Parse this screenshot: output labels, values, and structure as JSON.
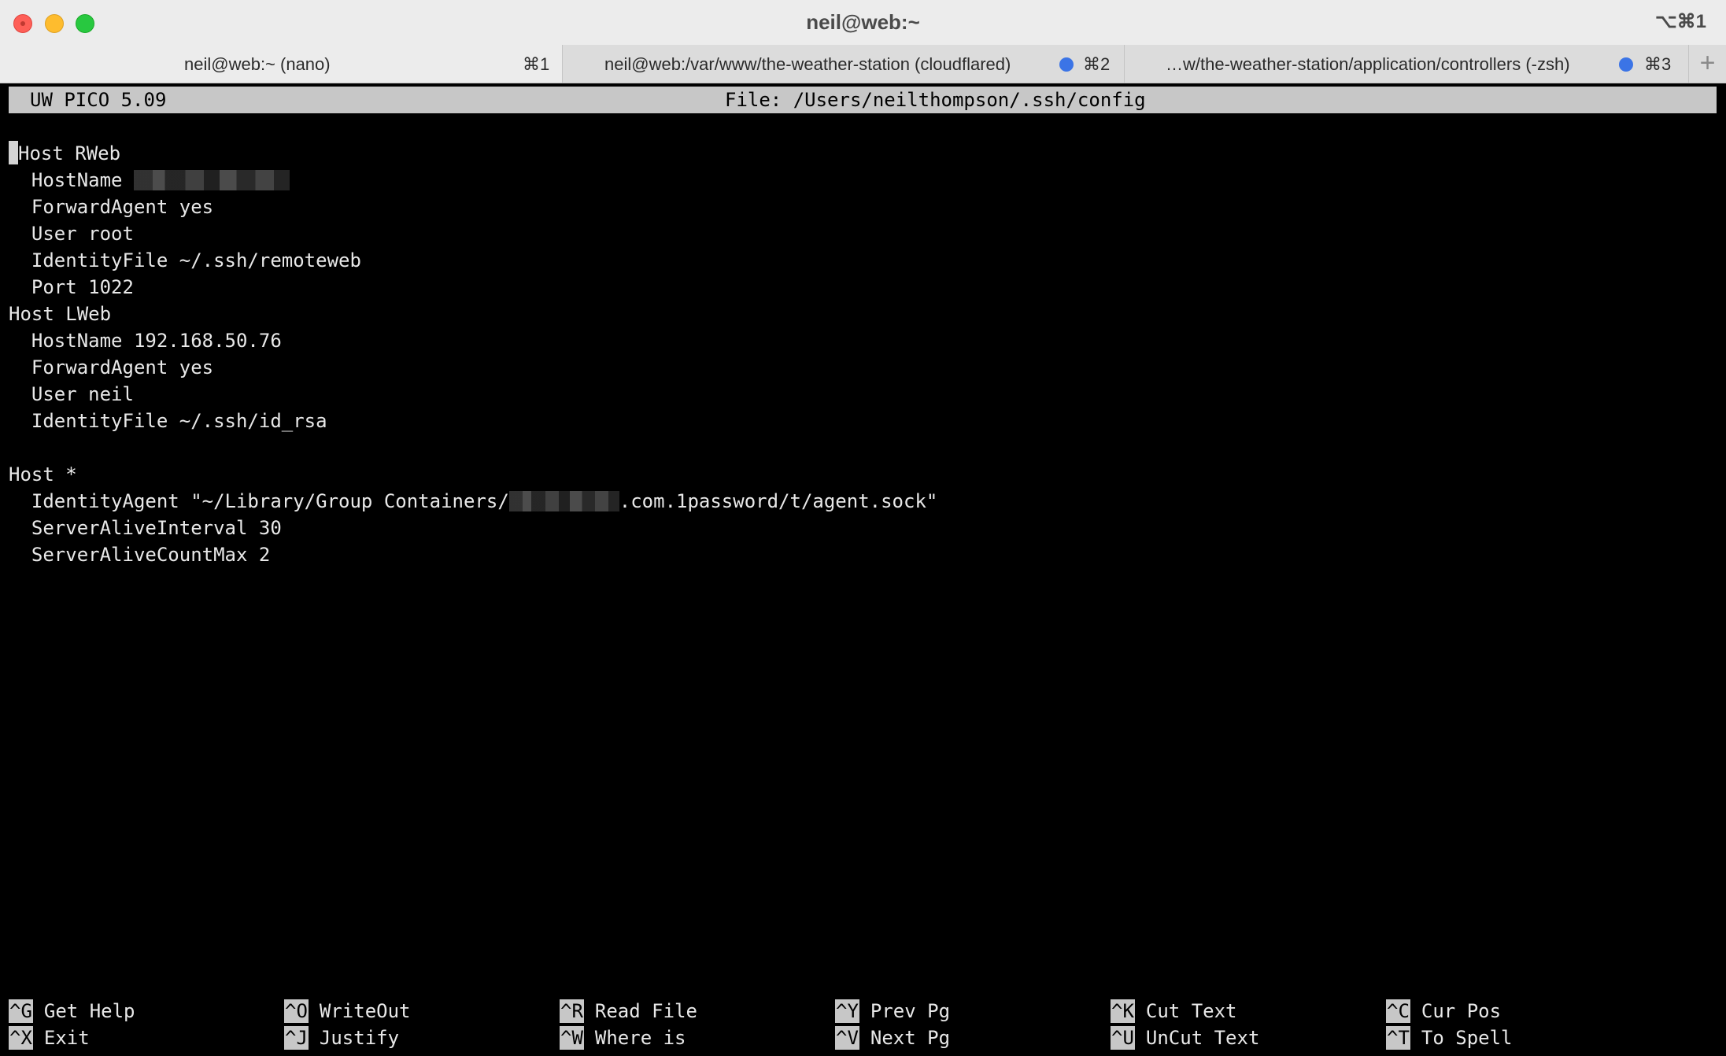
{
  "window": {
    "title": "neil@web:~",
    "shortcut": "⌥⌘1"
  },
  "tabs": [
    {
      "label": "neil@web:~ (nano)",
      "key": "⌘1",
      "active": true,
      "activity_dot": false
    },
    {
      "label": "neil@web:/var/www/the-weather-station (cloudflared)",
      "key": "⌘2",
      "active": false,
      "activity_dot": true
    },
    {
      "label": "…w/the-weather-station/application/controllers (-zsh)",
      "key": "⌘3",
      "active": false,
      "activity_dot": true
    }
  ],
  "new_tab_symbol": "+",
  "colors": {
    "activity_dot": "#3b74e6",
    "terminal_bg": "#000000",
    "terminal_fg": "#e8e8e8",
    "header_bg": "#c7c7c7"
  },
  "editor": {
    "name": "UW PICO 5.09",
    "file": "File: /Users/neilthompson/.ssh/config"
  },
  "lines": {
    "l1": "Host RWeb",
    "l2": "  HostName ",
    "l3": "  ForwardAgent yes",
    "l4": "  User root",
    "l5": "  IdentityFile ~/.ssh/remoteweb",
    "l6": "  Port 1022",
    "l7": "Host LWeb",
    "l8": "  HostName 192.168.50.76",
    "l9": "  ForwardAgent yes",
    "l10": "  User neil",
    "l11": "  IdentityFile ~/.ssh/id_rsa",
    "l12": "",
    "l13": "Host *",
    "l14a": "  IdentityAgent \"~/Library/Group Containers/",
    "l14b": ".com.1password/t/agent.sock\"",
    "l15": "  ServerAliveInterval 30",
    "l16": "  ServerAliveCountMax 2"
  },
  "shortcuts": [
    {
      "key": "^G",
      "label": "Get Help"
    },
    {
      "key": "^O",
      "label": "WriteOut"
    },
    {
      "key": "^R",
      "label": "Read File"
    },
    {
      "key": "^Y",
      "label": "Prev Pg"
    },
    {
      "key": "^K",
      "label": "Cut Text"
    },
    {
      "key": "^C",
      "label": "Cur Pos"
    },
    {
      "key": "^X",
      "label": "Exit"
    },
    {
      "key": "^J",
      "label": "Justify"
    },
    {
      "key": "^W",
      "label": "Where is"
    },
    {
      "key": "^V",
      "label": "Next Pg"
    },
    {
      "key": "^U",
      "label": "UnCut Text"
    },
    {
      "key": "^T",
      "label": "To Spell"
    }
  ]
}
